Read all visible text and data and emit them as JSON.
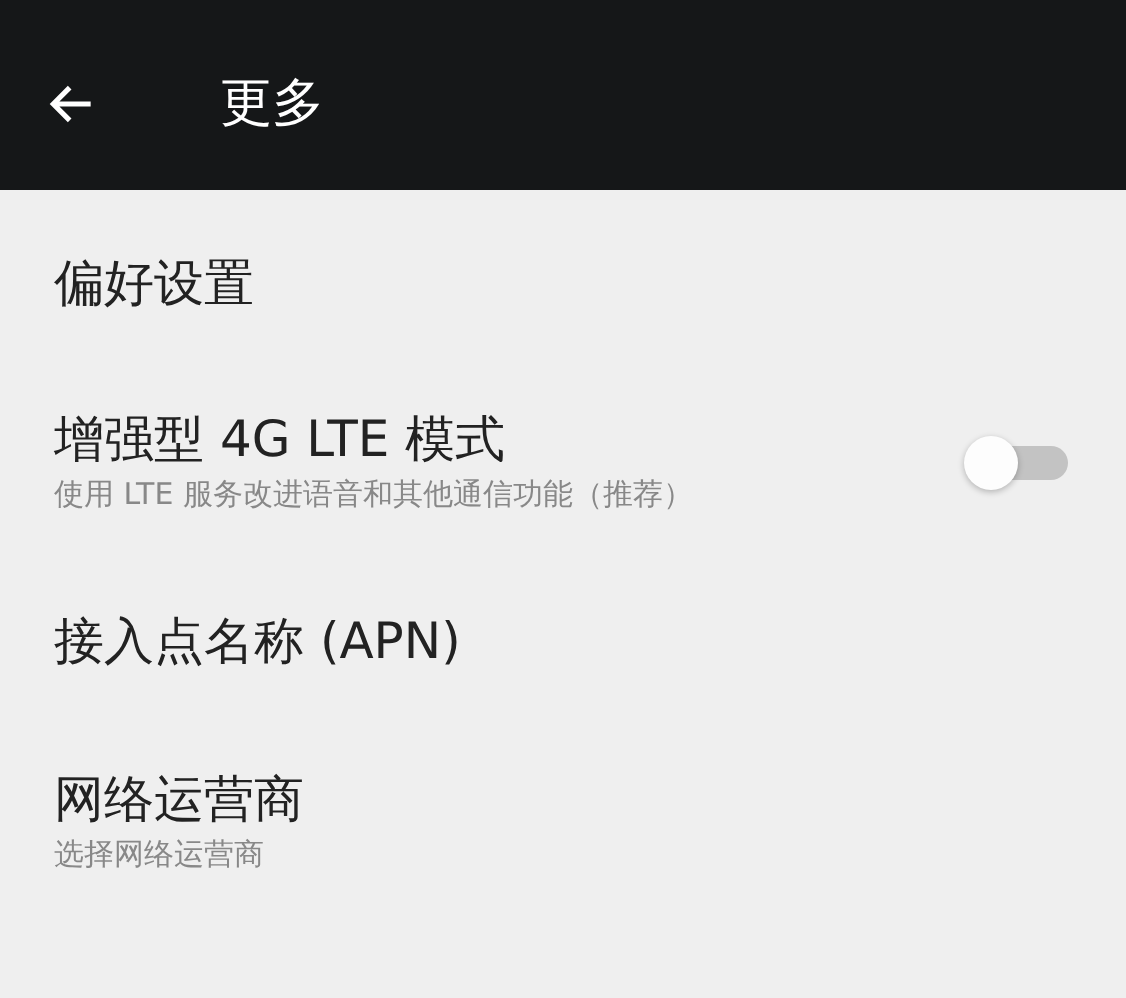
{
  "toolbar": {
    "title": "更多"
  },
  "category": "偏好设置",
  "items": [
    {
      "kind": "toggle",
      "title": "增强型 4G LTE 模式",
      "summary": "使用 LTE 服务改进语音和其他通信功能（推荐）",
      "on": false
    },
    {
      "kind": "plain",
      "title": "接入点名称 (APN)"
    },
    {
      "kind": "plain",
      "title": "网络运营商",
      "summary": "选择网络运营商"
    }
  ]
}
